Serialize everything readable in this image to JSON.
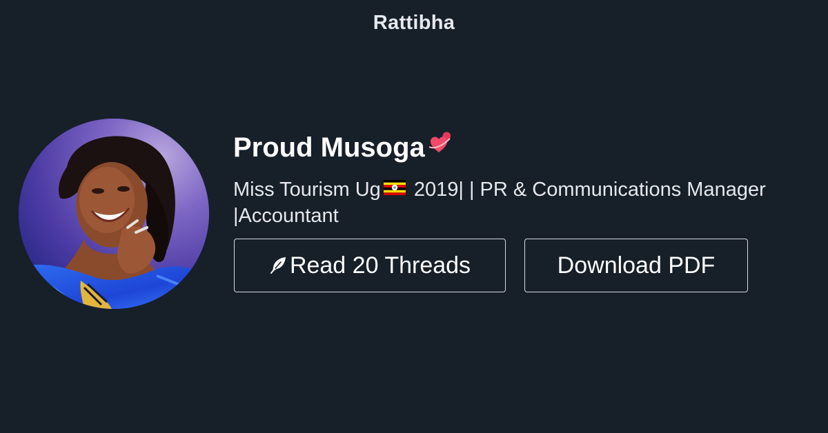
{
  "brand": {
    "name": "Rattibha"
  },
  "profile": {
    "display_name": "Proud Musoga",
    "name_emoji": "two-hearts-icon",
    "bio_part1": "Miss Tourism Ug",
    "bio_flag": "uganda-flag-icon",
    "bio_part2": " 2019| | PR & Communications Manager",
    "bio_line2": "|Accountant"
  },
  "actions": {
    "read_label": "Read 20 Threads",
    "read_icon": "feather-icon",
    "download_label": "Download PDF"
  },
  "colors": {
    "background": "#171f29",
    "text": "#ffffff",
    "button_border": "#d9dde3"
  }
}
